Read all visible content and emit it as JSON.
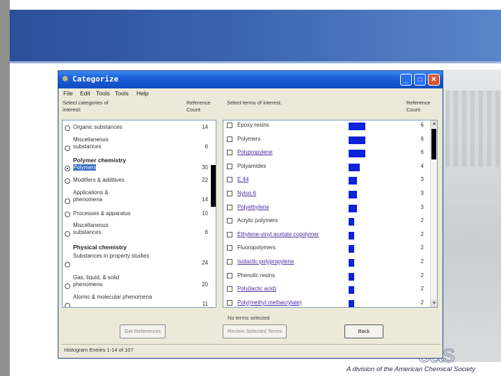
{
  "footer": {
    "tagline": "A division of the American Chemical Society",
    "logo": "cas"
  },
  "window": {
    "title": "Categorize",
    "icon": "flask-icon",
    "controls": {
      "minimize": "_",
      "maximize": "□",
      "close": "✕"
    }
  },
  "menu": [
    "File",
    "Edit",
    "Tools",
    "Tools",
    "Help"
  ],
  "left_panel": {
    "header": "Select categories of interest:",
    "count_header": "Reference Count",
    "rows": [
      {
        "label": "Organic substances",
        "count": "14",
        "selected": false
      },
      {
        "label": "Miscellaneous substances",
        "count": "6",
        "selected": false
      },
      {
        "group": "Polymer chemistry"
      },
      {
        "label": "Polymers",
        "count": "30",
        "selected": true
      },
      {
        "label": "Modifiers & additives",
        "count": "22",
        "selected": false
      },
      {
        "label": "Applications & phenomena",
        "count": "14",
        "selected": false
      },
      {
        "label": "Processes & apparatus",
        "count": "10",
        "selected": false
      },
      {
        "label": "Miscellaneous substances",
        "count": "6",
        "selected": false
      },
      {
        "group": "Physical chemistry"
      },
      {
        "label": "Substances in property studies",
        "count": "24",
        "selected": false
      },
      {
        "label": "Gas, liquid, & solid phenomena",
        "count": "20",
        "selected": false
      },
      {
        "label": "Atomic & molecular phenomena",
        "count": "11",
        "selected": false
      }
    ]
  },
  "right_panel": {
    "header": "Select terms of interest:",
    "count_header": "Reference Count",
    "terms": [
      {
        "label": "Epoxy resins",
        "count": "6",
        "fraction": 0.25,
        "link": false
      },
      {
        "label": "Polymers",
        "count": "6",
        "fraction": 0.25,
        "link": false
      },
      {
        "label": "Polypropylene",
        "count": "6",
        "fraction": 0.25,
        "link": true
      },
      {
        "label": "Polyamides",
        "count": "4",
        "fraction": 0.17,
        "link": false
      },
      {
        "label": "E 44",
        "count": "3",
        "fraction": 0.125,
        "link": true
      },
      {
        "label": "Nylon 6",
        "count": "3",
        "fraction": 0.125,
        "link": true
      },
      {
        "label": "Polyethylene",
        "count": "3",
        "fraction": 0.125,
        "link": true
      },
      {
        "label": "Acrylic polymers",
        "count": "2",
        "fraction": 0.08,
        "link": false
      },
      {
        "label": "Ethylene-vinyl acetate copolymer",
        "count": "2",
        "fraction": 0.08,
        "link": true
      },
      {
        "label": "Fluoropolymers",
        "count": "2",
        "fraction": 0.08,
        "link": false
      },
      {
        "label": "Isotactic polypropylene",
        "count": "2",
        "fraction": 0.08,
        "link": true
      },
      {
        "label": "Phenolic resins",
        "count": "2",
        "fraction": 0.08,
        "link": false
      },
      {
        "label": "Poly(lactic acid)",
        "count": "2",
        "fraction": 0.08,
        "link": true
      },
      {
        "label": "Poly(methyl methacrylate)",
        "count": "2",
        "fraction": 0.08,
        "link": true
      }
    ]
  },
  "status": {
    "selected_terms": "No terms selected",
    "bottom": "Histogram Entries 1-14 of 107"
  },
  "buttons": {
    "get_references": "Get References",
    "review": "Review Selected Terms",
    "back": "Back"
  },
  "colors": {
    "bar": "#0e22d8",
    "banner": "#2c4f9a"
  }
}
